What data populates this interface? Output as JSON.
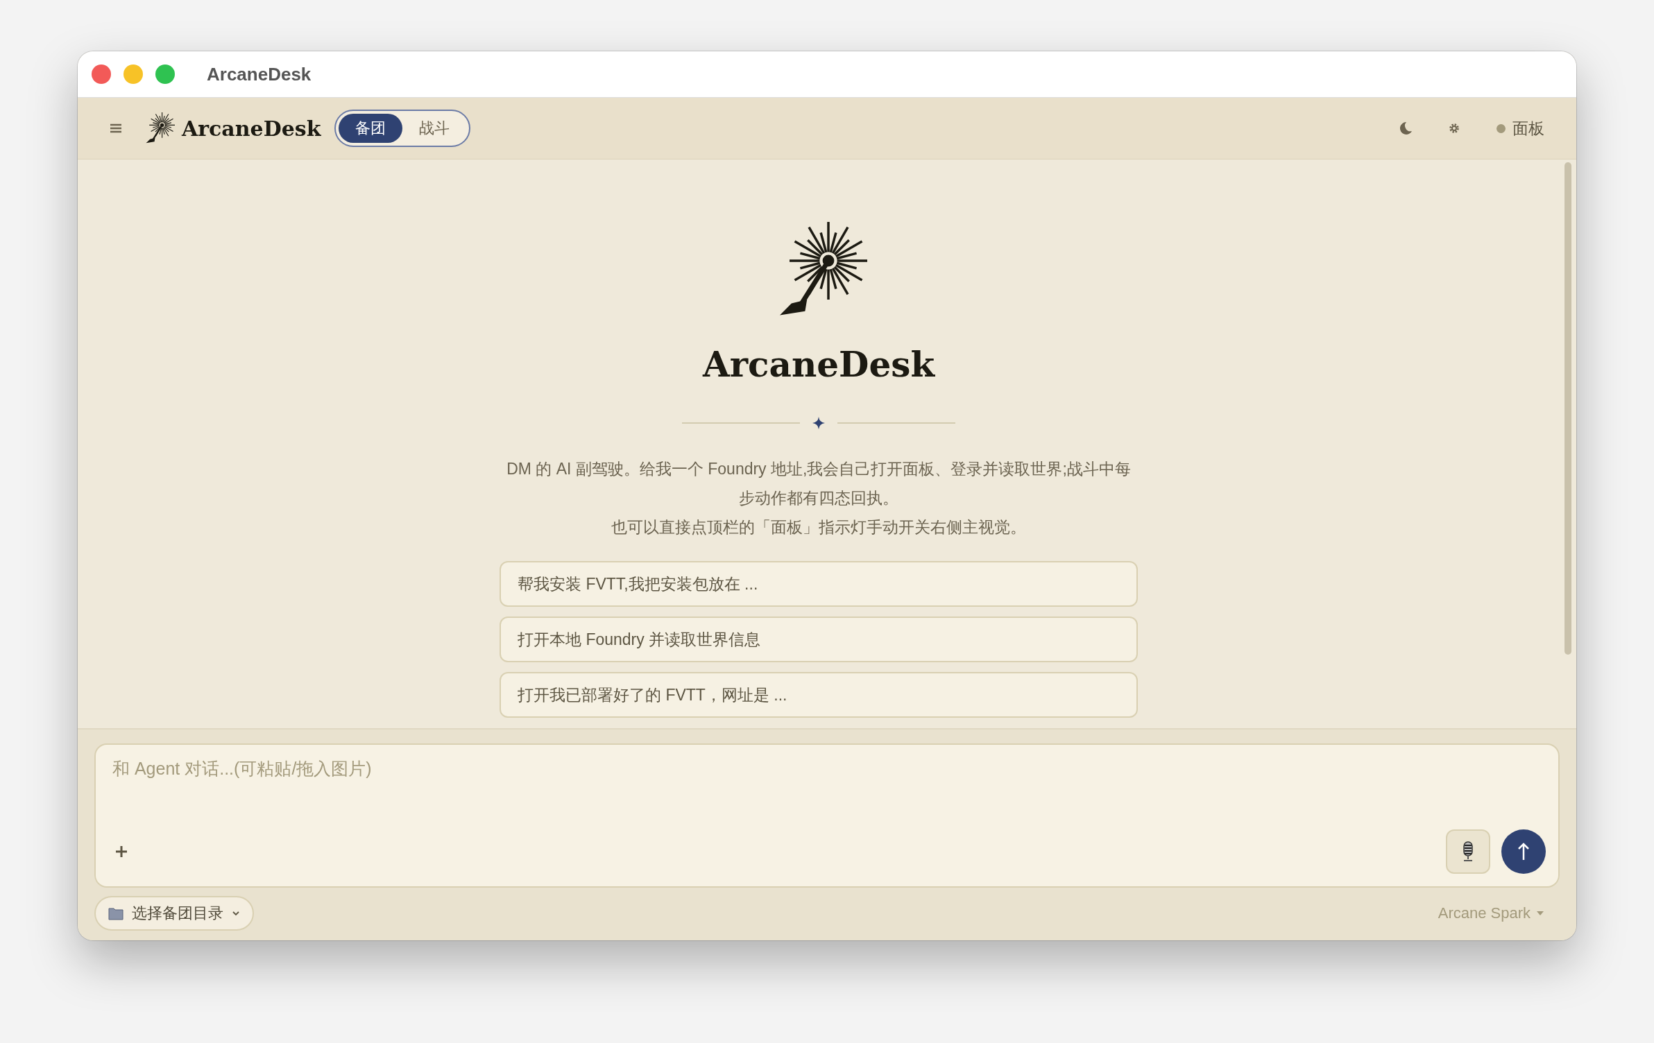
{
  "window": {
    "title": "ArcaneDesk"
  },
  "toolbar": {
    "brand": "ArcaneDesk",
    "modes": [
      {
        "label": "备团",
        "selected": true
      },
      {
        "label": "战斗",
        "selected": false
      }
    ],
    "panel_indicator": {
      "label": "面板",
      "on": false
    }
  },
  "hero": {
    "title": "ArcaneDesk",
    "description": [
      "DM 的 AI 副驾驶。给我一个 Foundry 地址,我会自己打开面板、登录并读取世界;战斗中每步动作都有四态回执。",
      "也可以直接点顶栏的「面板」指示灯手动开关右侧主视觉。"
    ]
  },
  "suggestions": [
    "帮我安装 FVTT,我把安装包放在 ...",
    "打开本地 Foundry 并读取世界信息",
    "打开我已部署好了的 FVTT，网址是 ..."
  ],
  "composer": {
    "placeholder": "和 Agent 对话...(可粘贴/拖入图片)"
  },
  "footer": {
    "directory": "选择备团目录",
    "model": "Arcane Spark"
  }
}
